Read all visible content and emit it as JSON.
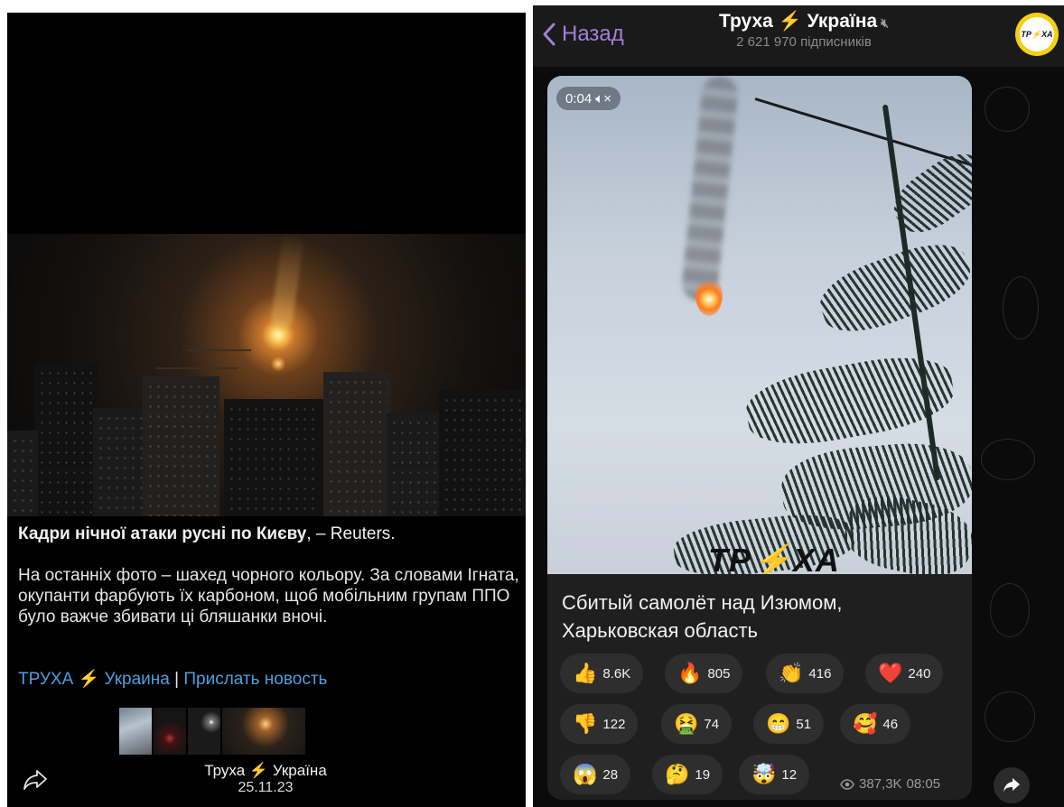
{
  "left_post": {
    "headline_bold": "Кадри нічної атаки русні по Києву",
    "headline_rest": ", – Reuters.",
    "body": "На останніх фото – шахед чорного кольору. За словами Ігната, окупанти фарбують їх карбоном, щоб мобільним групам ППО було важче збивати ці бляшанки вночі.",
    "link_channel": "ТРУХА",
    "link_channel_suffix": "Украина",
    "link_separator": "|",
    "link_submit": "Прислать новость",
    "footer_channel": "Труха",
    "footer_channel_suffix": "Україна",
    "footer_date": "25.11.23"
  },
  "right_post": {
    "back_label": "Назад",
    "channel_title": "Труха",
    "channel_title_suffix": "Україна",
    "subscribers": "2 621 970 підписників",
    "avatar_text": "ТР⚡ХА",
    "video_time": "0:04",
    "video_logo": "ТР",
    "video_logo_suffix": "ХА",
    "message": "Сбитый самолёт над Изюмом, Харьковская область",
    "reactions": [
      {
        "emoji": "👍",
        "count": "8.6K"
      },
      {
        "emoji": "🔥",
        "count": "805"
      },
      {
        "emoji": "👏",
        "count": "416"
      },
      {
        "emoji": "❤️",
        "count": "240"
      },
      {
        "emoji": "👎",
        "count": "122"
      },
      {
        "emoji": "🤮",
        "count": "74"
      },
      {
        "emoji": "😁",
        "count": "51"
      },
      {
        "emoji": "🥰",
        "count": "46"
      },
      {
        "emoji": "😱",
        "count": "28"
      },
      {
        "emoji": "🤔",
        "count": "19"
      },
      {
        "emoji": "🤯",
        "count": "12"
      }
    ],
    "views": "387,3K",
    "time": "08:05"
  },
  "colors": {
    "link_blue": "#4f9fe0",
    "back_purple": "#a37fd8",
    "bolt_yellow": "#f5c518",
    "bubble_bg": "#1f1f1f",
    "reaction_bg": "#2e2e2e"
  }
}
